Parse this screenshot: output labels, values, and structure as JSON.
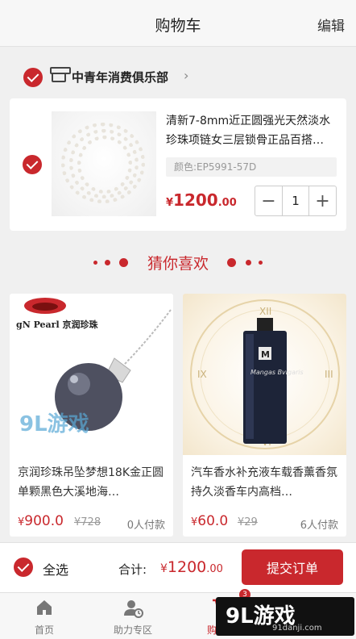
{
  "header": {
    "title": "购物车",
    "edit_label": "编辑"
  },
  "store": {
    "name": "中青年消费俱乐部",
    "chevron": "›"
  },
  "cart_item": {
    "title": "清新7-8mm近正圆强光天然淡水珍珠项链女三层锁骨正品百搭…",
    "spec": "颜色:EP5991-57D",
    "price_yen": "¥",
    "price_main": "1200",
    "price_decimal": ".00",
    "quantity": "1",
    "minus": "−",
    "plus": "+"
  },
  "guess": {
    "title": "猜你喜欢"
  },
  "recommendations": [
    {
      "brand_text": "gN Pearl 京润珍珠",
      "title": "京润珍珠吊坠梦想18K金正圆单颗黑色大溪地海…",
      "price_yen": "¥",
      "price": "900.0",
      "old_price": "¥728",
      "paid": "0人付款"
    },
    {
      "brand_text": "Mangas Bvlgaris",
      "title": "汽车香水补充液车载香薰香氛持久淡香车内高档…",
      "price_yen": "¥",
      "price": "60.0",
      "old_price": "¥29",
      "paid": "6人付款"
    }
  ],
  "bottom_bar": {
    "select_all": "全选",
    "total_label": "合计:",
    "total_yen": "¥",
    "total_main": "1200",
    "total_decimal": ".00",
    "submit": "提交订单"
  },
  "tabs": [
    {
      "label": "首页",
      "icon": "home-icon"
    },
    {
      "label": "助力专区",
      "icon": "assist-icon"
    },
    {
      "label": "购物车",
      "icon": "cart-icon"
    }
  ],
  "cart_badge": "3",
  "watermark": {
    "text": "9L游戏",
    "sub": "91danji.com"
  },
  "colors": {
    "accent": "#c9282d",
    "text": "#222222",
    "muted": "#999999",
    "background": "#f0f0f0"
  }
}
